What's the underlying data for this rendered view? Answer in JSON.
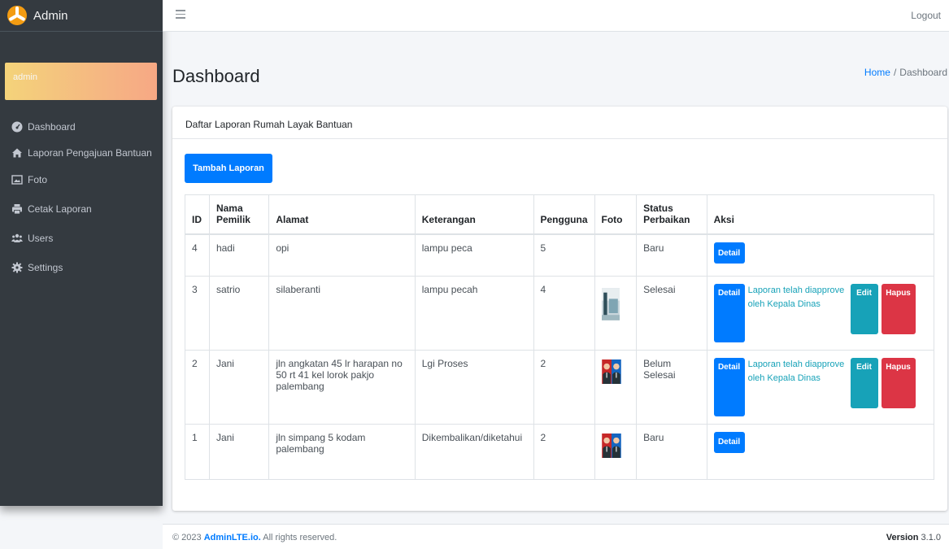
{
  "brand": {
    "title": "Admin",
    "logo_icon": "adminlte-logo-icon"
  },
  "user_panel": {
    "name": "admin"
  },
  "sidebar": {
    "items": [
      {
        "label": "Dashboard",
        "icon": "tachometer-icon"
      },
      {
        "label": "Laporan Pengajuan Bantuan",
        "icon": "home-icon"
      },
      {
        "label": "Foto",
        "icon": "image-icon"
      },
      {
        "label": "Cetak Laporan",
        "icon": "print-icon"
      },
      {
        "label": "Users",
        "icon": "users-icon"
      },
      {
        "label": "Settings",
        "icon": "gear-icon"
      }
    ]
  },
  "navbar": {
    "logout_label": "Logout"
  },
  "header": {
    "title": "Dashboard",
    "breadcrumb": {
      "home": "Home",
      "separator": "/",
      "current": "Dashboard"
    }
  },
  "card": {
    "title": "Daftar Laporan Rumah Layak Bantuan",
    "add_button": "Tambah Laporan"
  },
  "table": {
    "headers": {
      "id": "ID",
      "nama_pemilik": "Nama Pemilik",
      "alamat": "Alamat",
      "keterangan": "Keterangan",
      "pengguna": "Pengguna",
      "foto": "Foto",
      "status_perbaikan": "Status Perbaikan",
      "aksi": "Aksi"
    },
    "rows": [
      {
        "id": "4",
        "nama": "hadi",
        "alamat": "opi",
        "keterangan": "lampu peca",
        "pengguna": "5",
        "status": "Baru"
      },
      {
        "id": "3",
        "nama": "satrio",
        "alamat": "silaberanti",
        "keterangan": "lampu pecah",
        "pengguna": "4",
        "status": "Selesai"
      },
      {
        "id": "2",
        "nama": "Jani",
        "alamat": "jln angkatan 45 lr harapan no 50 rt 41 kel lorok pakjo palembang",
        "keterangan": "Lgi Proses",
        "pengguna": "2",
        "status": "Belum Selesai"
      },
      {
        "id": "1",
        "nama": "Jani",
        "alamat": "jln simpang 5 kodam palembang",
        "keterangan": "Dikembalikan/diketahui",
        "pengguna": "2",
        "status": "Baru"
      }
    ],
    "actions": {
      "detail": "Detail",
      "edit": "Edit",
      "hapus": "Hapus",
      "approved_message": "Laporan telah diapprove oleh Kepala Dinas"
    }
  },
  "footer": {
    "copyright_prefix": "© 2023 ",
    "brand_link": "AdminLTE.io.",
    "copyright_suffix": " All rights reserved.",
    "version_label": "Version",
    "version_number": " 3.1.0"
  },
  "colors": {
    "primary": "#007bff",
    "info": "#17a2b8",
    "danger": "#dc3545",
    "sidebar": "#343a40"
  }
}
